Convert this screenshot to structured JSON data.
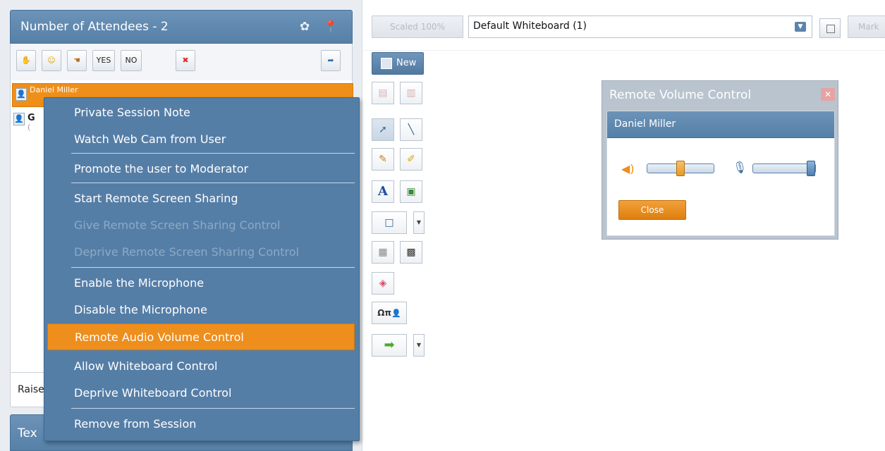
{
  "attendees": {
    "header_title": "Number of Attendees - 2",
    "toolbar": {
      "yes_label": "YES",
      "no_label": "NO"
    },
    "selected_user": "Daniel Miller",
    "second_user_initial": "G",
    "second_user_sub": "(",
    "raise_label": "Raise",
    "text_header": "Tex"
  },
  "context_menu": {
    "items": [
      {
        "label": "Private Session Note",
        "state": "enabled"
      },
      {
        "label": "Watch Web Cam from User",
        "state": "enabled"
      },
      {
        "label": "Promote the user to Moderator",
        "state": "enabled"
      },
      {
        "label": "Start Remote Screen Sharing",
        "state": "enabled"
      },
      {
        "label": "Give Remote Screen Sharing Control",
        "state": "disabled"
      },
      {
        "label": "Deprive Remote Screen Sharing Control",
        "state": "disabled"
      },
      {
        "label": "Enable the Microphone",
        "state": "enabled"
      },
      {
        "label": "Disable the Microphone",
        "state": "enabled"
      },
      {
        "label": "Remote Audio Volume Control",
        "state": "highlighted"
      },
      {
        "label": "Allow Whiteboard Control",
        "state": "enabled"
      },
      {
        "label": "Deprive Whiteboard Control",
        "state": "enabled"
      },
      {
        "label": "Remove from Session",
        "state": "enabled"
      }
    ]
  },
  "whiteboard": {
    "scaled_label": "Scaled 100%",
    "selected_board": "Default Whiteboard (1)",
    "mark_label": "Mark",
    "new_label": "New",
    "symbols_label": "Ωπ"
  },
  "volume_dialog": {
    "title": "Remote Volume Control",
    "user_name": "Daniel Miller",
    "speaker_level": 0.5,
    "mic_level": 1.0,
    "close_label": "Close"
  },
  "colors": {
    "accent_orange": "#ee8e1c",
    "header_blue": "#5580a8"
  }
}
